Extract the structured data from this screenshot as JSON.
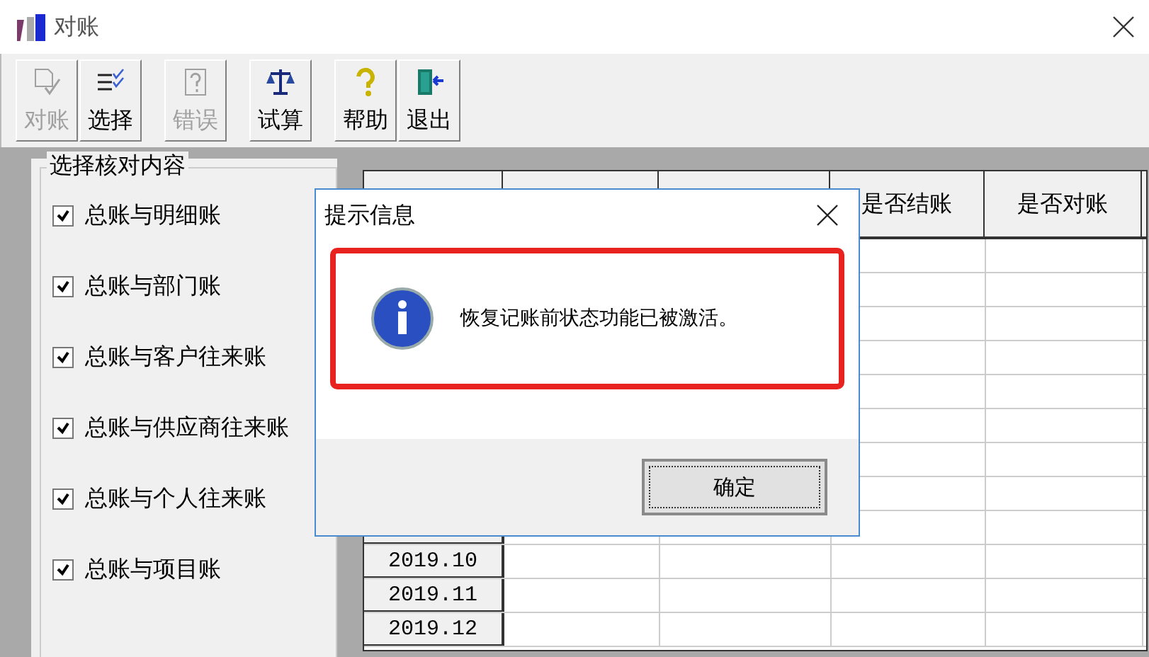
{
  "window": {
    "title": "对账"
  },
  "toolbar": [
    {
      "label": "对账",
      "disabled": true
    },
    {
      "label": "选择",
      "disabled": false
    },
    {
      "label": "错误",
      "disabled": true
    },
    {
      "label": "试算",
      "disabled": false
    },
    {
      "label": "帮助",
      "disabled": false
    },
    {
      "label": "退出",
      "disabled": false
    }
  ],
  "check_group": {
    "title": "选择核对内容",
    "items": [
      {
        "label": "总账与明细账",
        "checked": true
      },
      {
        "label": "总账与部门账",
        "checked": true
      },
      {
        "label": "总账与客户往来账",
        "checked": true
      },
      {
        "label": "总账与供应商往来账",
        "checked": true
      },
      {
        "label": "总账与个人往来账",
        "checked": true
      },
      {
        "label": "总账与项目账",
        "checked": true
      }
    ]
  },
  "table": {
    "columns": [
      "是否结账",
      "是否对账"
    ],
    "rows": [
      "2019.10",
      "2019.11",
      "2019.12"
    ]
  },
  "dialog": {
    "title": "提示信息",
    "message": "恢复记账前状态功能已被激活。",
    "button": "确定"
  }
}
